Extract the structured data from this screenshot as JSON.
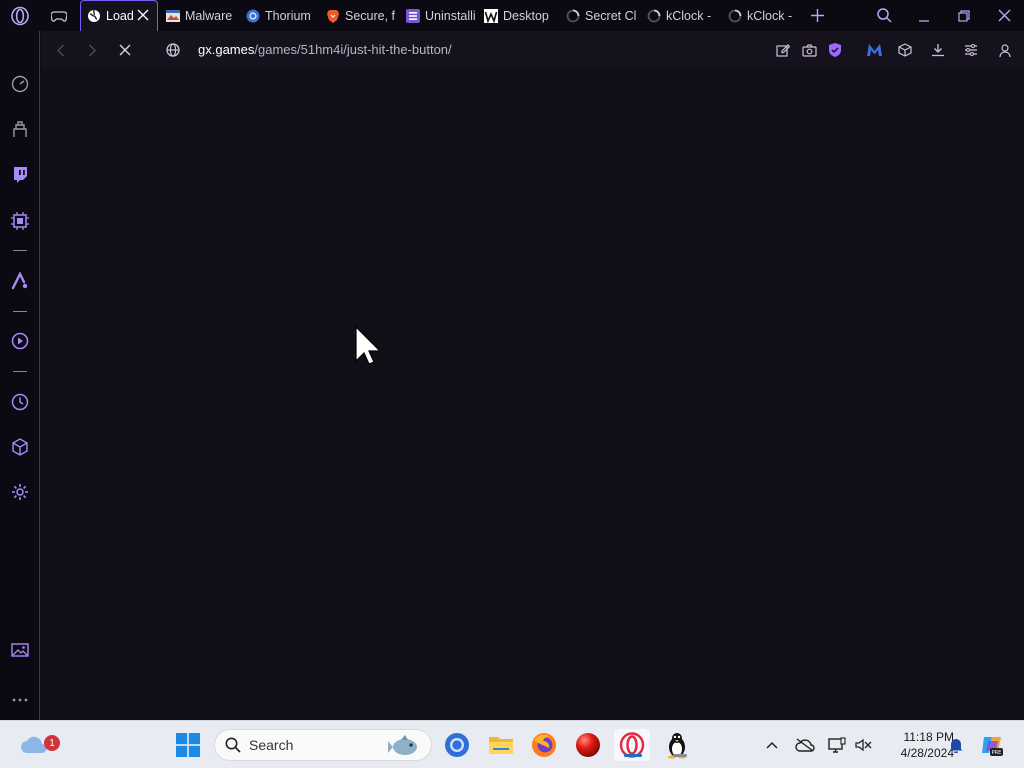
{
  "browser": {
    "tabs": [
      {
        "label": "Load",
        "icon": "globe-icon",
        "active": true
      },
      {
        "label": "Malware",
        "icon": "malware-site-icon"
      },
      {
        "label": "Thorium",
        "icon": "thorium-icon"
      },
      {
        "label": "Secure, f",
        "icon": "brave-icon"
      },
      {
        "label": "Uninstalli",
        "icon": "list-app-icon"
      },
      {
        "label": "Desktop",
        "icon": "w-logo-icon"
      },
      {
        "label": "Secret Cl",
        "icon": "loading-spinner-icon"
      },
      {
        "label": "kClock -",
        "icon": "loading-spinner-icon"
      },
      {
        "label": "kClock -",
        "icon": "loading-spinner-icon"
      }
    ],
    "url": {
      "host": "gx.games",
      "path": "/games/51hm4i/just-hit-the-button/"
    }
  },
  "taskbar": {
    "search_placeholder": "Search",
    "notification_count": "1",
    "time": "11:18 PM",
    "date": "4/28/2024",
    "apps": [
      "windows-start-icon",
      "chromium-icon",
      "file-explorer-icon",
      "firefox-icon",
      "red-ball-app-icon",
      "opera-gx-icon",
      "linux-penguin-icon"
    ]
  },
  "colors": {
    "accent": "#7a5ef8",
    "background": "#110e18",
    "taskbar": "#e9ebf2"
  }
}
